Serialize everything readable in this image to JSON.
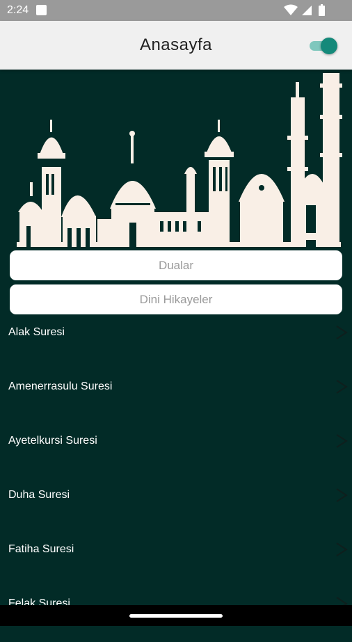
{
  "status_bar": {
    "time": "2:24"
  },
  "app_bar": {
    "title": "Anasayfa",
    "toggle_on": true
  },
  "colors": {
    "background": "#022b27",
    "accent": "#14897a",
    "mosque": "#f9efe6"
  },
  "buttons": {
    "dualar": "Dualar",
    "hikayeler": "Dini Hikayeler"
  },
  "list": [
    {
      "label": "Alak Suresi"
    },
    {
      "label": "Amenerrasulu Suresi"
    },
    {
      "label": "Ayetelkursi Suresi"
    },
    {
      "label": "Duha Suresi"
    },
    {
      "label": "Fatiha Suresi"
    },
    {
      "label": "Felak Suresi"
    }
  ]
}
